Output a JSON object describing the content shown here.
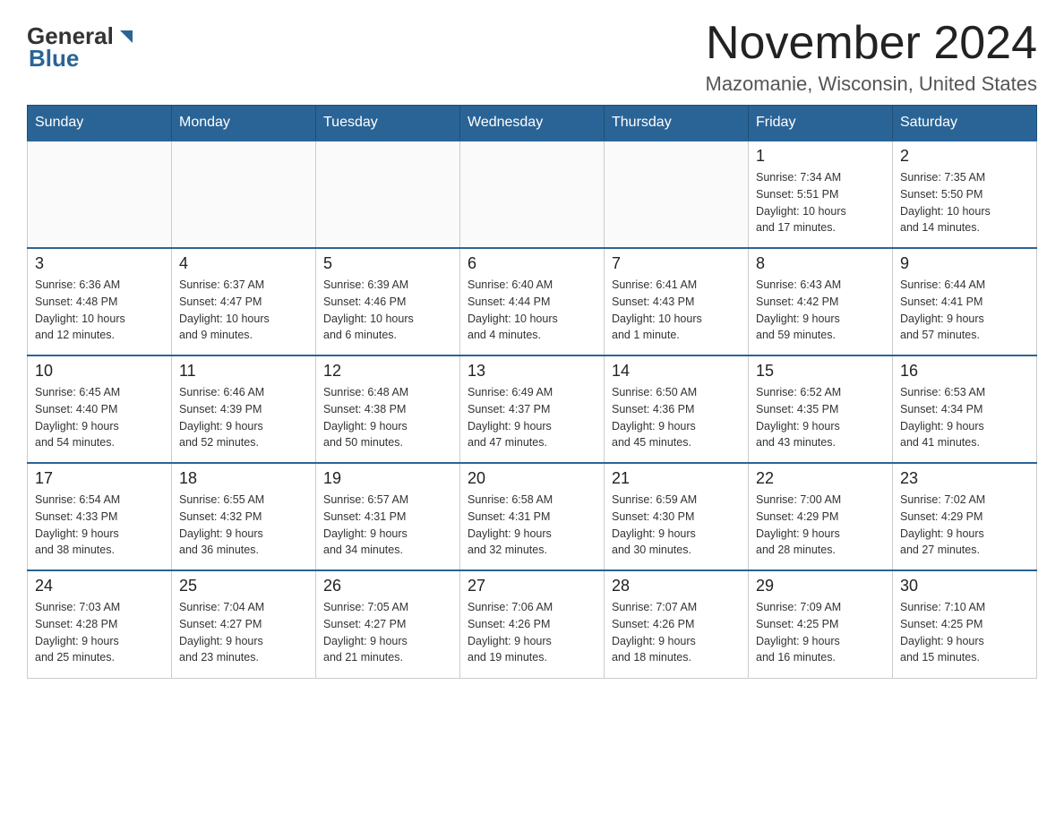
{
  "header": {
    "logo_general": "General",
    "logo_blue": "Blue",
    "month_title": "November 2024",
    "location": "Mazomanie, Wisconsin, United States"
  },
  "weekdays": [
    "Sunday",
    "Monday",
    "Tuesday",
    "Wednesday",
    "Thursday",
    "Friday",
    "Saturday"
  ],
  "weeks": [
    [
      {
        "day": "",
        "info": ""
      },
      {
        "day": "",
        "info": ""
      },
      {
        "day": "",
        "info": ""
      },
      {
        "day": "",
        "info": ""
      },
      {
        "day": "",
        "info": ""
      },
      {
        "day": "1",
        "info": "Sunrise: 7:34 AM\nSunset: 5:51 PM\nDaylight: 10 hours\nand 17 minutes."
      },
      {
        "day": "2",
        "info": "Sunrise: 7:35 AM\nSunset: 5:50 PM\nDaylight: 10 hours\nand 14 minutes."
      }
    ],
    [
      {
        "day": "3",
        "info": "Sunrise: 6:36 AM\nSunset: 4:48 PM\nDaylight: 10 hours\nand 12 minutes."
      },
      {
        "day": "4",
        "info": "Sunrise: 6:37 AM\nSunset: 4:47 PM\nDaylight: 10 hours\nand 9 minutes."
      },
      {
        "day": "5",
        "info": "Sunrise: 6:39 AM\nSunset: 4:46 PM\nDaylight: 10 hours\nand 6 minutes."
      },
      {
        "day": "6",
        "info": "Sunrise: 6:40 AM\nSunset: 4:44 PM\nDaylight: 10 hours\nand 4 minutes."
      },
      {
        "day": "7",
        "info": "Sunrise: 6:41 AM\nSunset: 4:43 PM\nDaylight: 10 hours\nand 1 minute."
      },
      {
        "day": "8",
        "info": "Sunrise: 6:43 AM\nSunset: 4:42 PM\nDaylight: 9 hours\nand 59 minutes."
      },
      {
        "day": "9",
        "info": "Sunrise: 6:44 AM\nSunset: 4:41 PM\nDaylight: 9 hours\nand 57 minutes."
      }
    ],
    [
      {
        "day": "10",
        "info": "Sunrise: 6:45 AM\nSunset: 4:40 PM\nDaylight: 9 hours\nand 54 minutes."
      },
      {
        "day": "11",
        "info": "Sunrise: 6:46 AM\nSunset: 4:39 PM\nDaylight: 9 hours\nand 52 minutes."
      },
      {
        "day": "12",
        "info": "Sunrise: 6:48 AM\nSunset: 4:38 PM\nDaylight: 9 hours\nand 50 minutes."
      },
      {
        "day": "13",
        "info": "Sunrise: 6:49 AM\nSunset: 4:37 PM\nDaylight: 9 hours\nand 47 minutes."
      },
      {
        "day": "14",
        "info": "Sunrise: 6:50 AM\nSunset: 4:36 PM\nDaylight: 9 hours\nand 45 minutes."
      },
      {
        "day": "15",
        "info": "Sunrise: 6:52 AM\nSunset: 4:35 PM\nDaylight: 9 hours\nand 43 minutes."
      },
      {
        "day": "16",
        "info": "Sunrise: 6:53 AM\nSunset: 4:34 PM\nDaylight: 9 hours\nand 41 minutes."
      }
    ],
    [
      {
        "day": "17",
        "info": "Sunrise: 6:54 AM\nSunset: 4:33 PM\nDaylight: 9 hours\nand 38 minutes."
      },
      {
        "day": "18",
        "info": "Sunrise: 6:55 AM\nSunset: 4:32 PM\nDaylight: 9 hours\nand 36 minutes."
      },
      {
        "day": "19",
        "info": "Sunrise: 6:57 AM\nSunset: 4:31 PM\nDaylight: 9 hours\nand 34 minutes."
      },
      {
        "day": "20",
        "info": "Sunrise: 6:58 AM\nSunset: 4:31 PM\nDaylight: 9 hours\nand 32 minutes."
      },
      {
        "day": "21",
        "info": "Sunrise: 6:59 AM\nSunset: 4:30 PM\nDaylight: 9 hours\nand 30 minutes."
      },
      {
        "day": "22",
        "info": "Sunrise: 7:00 AM\nSunset: 4:29 PM\nDaylight: 9 hours\nand 28 minutes."
      },
      {
        "day": "23",
        "info": "Sunrise: 7:02 AM\nSunset: 4:29 PM\nDaylight: 9 hours\nand 27 minutes."
      }
    ],
    [
      {
        "day": "24",
        "info": "Sunrise: 7:03 AM\nSunset: 4:28 PM\nDaylight: 9 hours\nand 25 minutes."
      },
      {
        "day": "25",
        "info": "Sunrise: 7:04 AM\nSunset: 4:27 PM\nDaylight: 9 hours\nand 23 minutes."
      },
      {
        "day": "26",
        "info": "Sunrise: 7:05 AM\nSunset: 4:27 PM\nDaylight: 9 hours\nand 21 minutes."
      },
      {
        "day": "27",
        "info": "Sunrise: 7:06 AM\nSunset: 4:26 PM\nDaylight: 9 hours\nand 19 minutes."
      },
      {
        "day": "28",
        "info": "Sunrise: 7:07 AM\nSunset: 4:26 PM\nDaylight: 9 hours\nand 18 minutes."
      },
      {
        "day": "29",
        "info": "Sunrise: 7:09 AM\nSunset: 4:25 PM\nDaylight: 9 hours\nand 16 minutes."
      },
      {
        "day": "30",
        "info": "Sunrise: 7:10 AM\nSunset: 4:25 PM\nDaylight: 9 hours\nand 15 minutes."
      }
    ]
  ]
}
